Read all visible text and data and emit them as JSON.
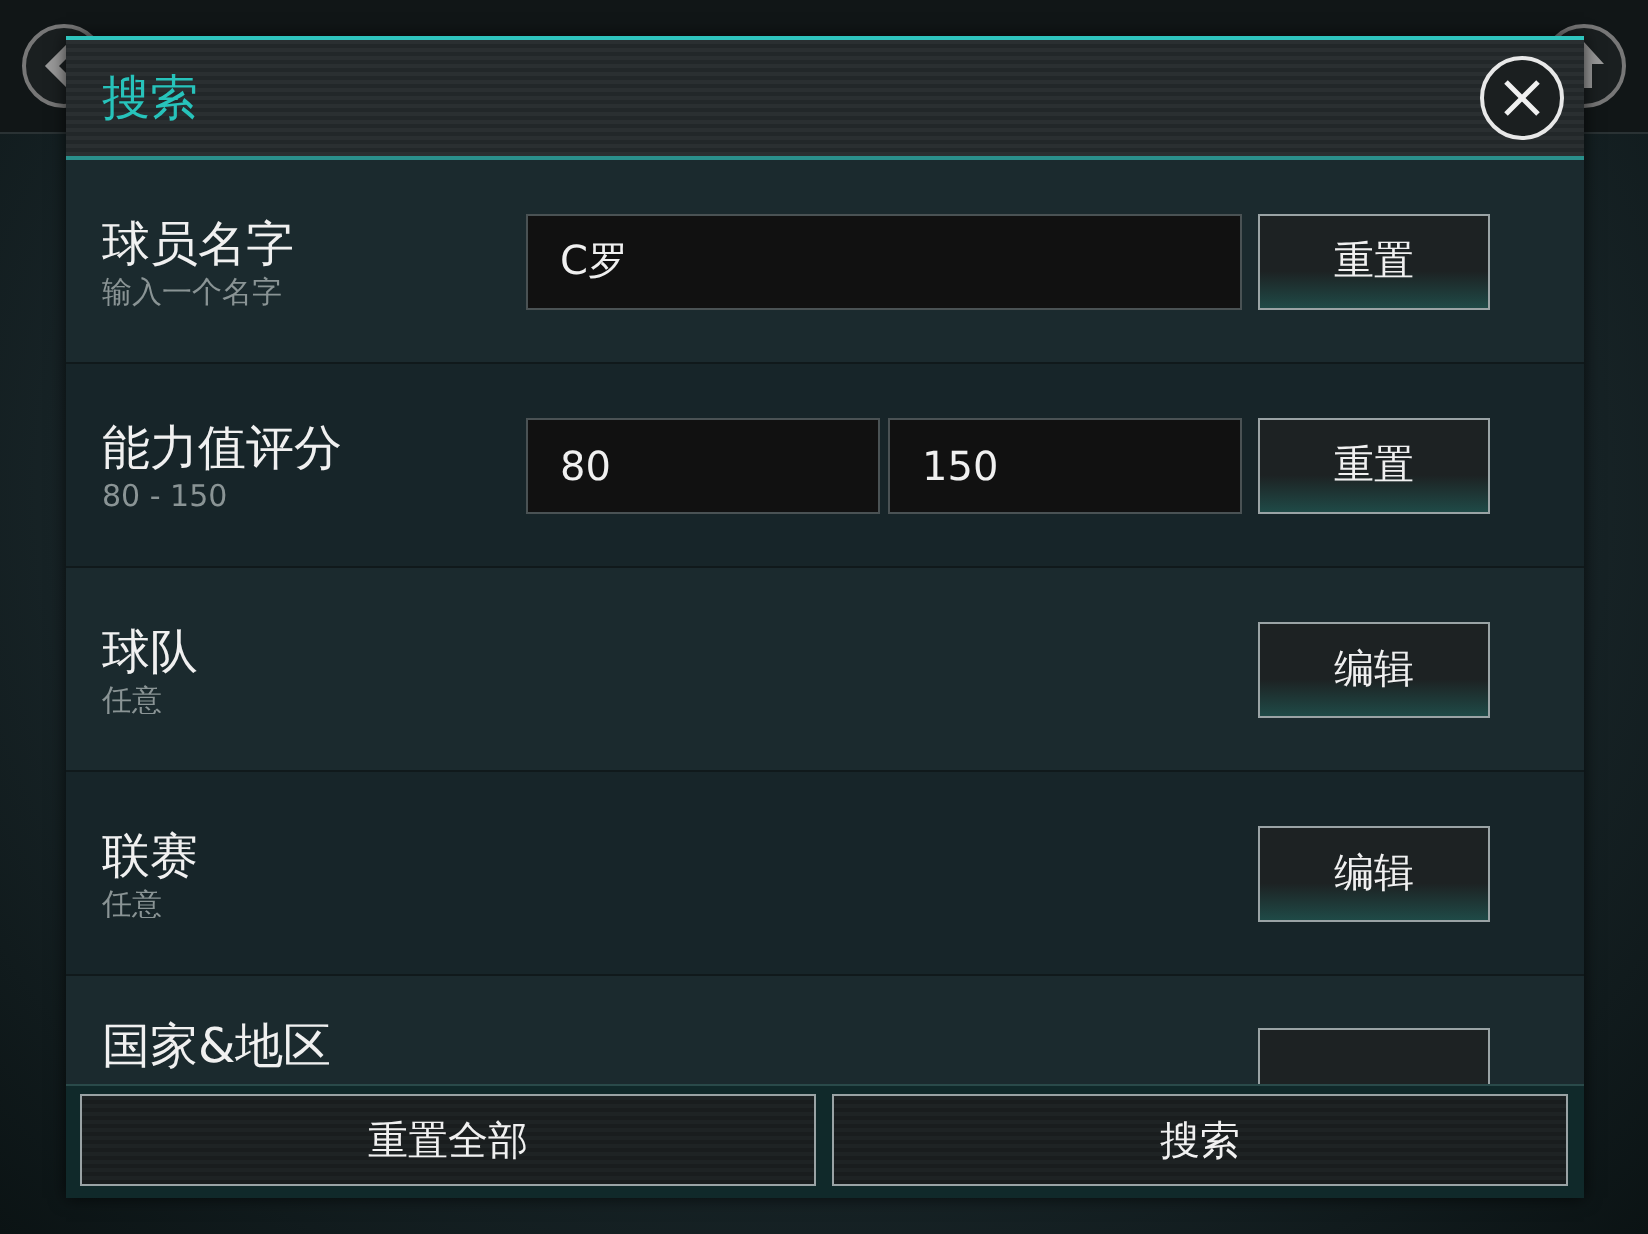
{
  "dialog": {
    "title": "搜索"
  },
  "rows": [
    {
      "kind": "text",
      "label": "球员名字",
      "hint": "输入一个名字",
      "values": [
        "C罗"
      ],
      "button": "重置"
    },
    {
      "kind": "range",
      "label": "能力值评分",
      "hint": "80 - 150",
      "values": [
        "80",
        "150"
      ],
      "button": "重置"
    },
    {
      "kind": "picker",
      "label": "球队",
      "hint": "任意",
      "button": "编辑"
    },
    {
      "kind": "picker",
      "label": "联赛",
      "hint": "任意",
      "button": "编辑"
    },
    {
      "kind": "picker",
      "label": "国家&地区"
    }
  ],
  "footer": {
    "buttons": [
      "重置全部",
      "搜索"
    ]
  }
}
